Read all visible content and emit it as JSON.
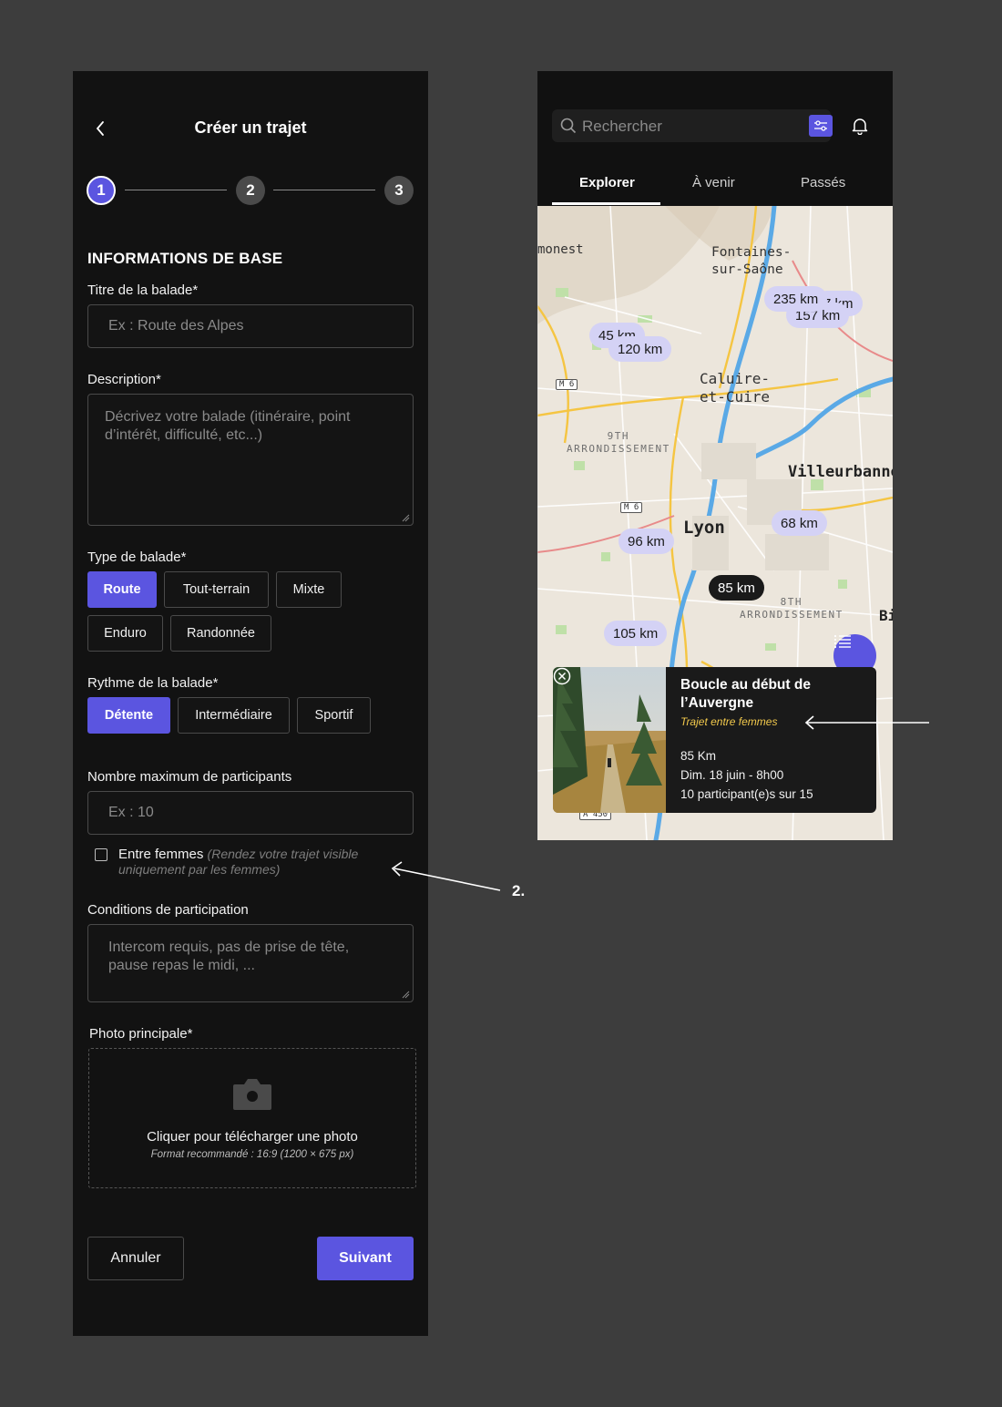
{
  "form": {
    "title": "Créer un trajet",
    "steps": [
      "1",
      "2",
      "3"
    ],
    "section_title": "INFORMATIONS DE BASE",
    "title_label": "Titre de la balade*",
    "title_placeholder": "Ex : Route des Alpes",
    "description_label": "Description*",
    "description_placeholder_1": "Décrivez votre balade (itinéraire, point",
    "description_placeholder_2": "d’intérêt, difficulté, etc...)",
    "type_label": "Type de balade*",
    "type_options": [
      "Route",
      "Tout-terrain",
      "Mixte",
      "Enduro",
      "Randonnée"
    ],
    "type_selected": "Route",
    "pace_label": "Rythme de la balade*",
    "pace_options": [
      "Détente",
      "Intermédiaire",
      "Sportif"
    ],
    "pace_selected": "Détente",
    "max_label": "Nombre maximum de participants",
    "max_placeholder": "Ex : 10",
    "women_label": "Entre femmes",
    "women_hint_1": "(Rendez votre trajet visible",
    "women_hint_2": "uniquement par les femmes)",
    "conditions_label": "Conditions de participation",
    "conditions_placeholder_1": "Intercom requis, pas de prise de tête,",
    "conditions_placeholder_2": "pause repas le midi, ...",
    "photo_label": "Photo principale*",
    "upload_text": "Cliquer pour télécharger une photo",
    "upload_hint": "Format recommandé : 16:9 (1200 × 675 px)",
    "cancel": "Annuler",
    "next": "Suivant"
  },
  "explore": {
    "search_placeholder": "Rechercher",
    "tabs": [
      "Explorer",
      "À venir",
      "Passés"
    ],
    "active_tab": "Explorer",
    "places": {
      "monest": "monest",
      "fontaines_1": "Fontaines-",
      "fontaines_2": "sur-Saône",
      "caluire_1": "Caluire-",
      "caluire_2": "et-Cuire",
      "arr9_1": "9TH",
      "arr9_2": "ARRONDISSEMENT",
      "villeurbanne": "Villeurbanne",
      "lyon": "Lyon",
      "arr8_1": "8TH",
      "arr8_2": "ARRONDISSEMENT",
      "m6": "M 6",
      "a450": "A 450",
      "bi": "Bi"
    },
    "markers": [
      "235 km",
      "7 km",
      "157 km",
      "45 km",
      "120 km",
      "68 km",
      "96 km",
      "85 km",
      "105 km"
    ],
    "selected_marker": "85 km",
    "card": {
      "title": "Boucle au début de l’Auvergne",
      "tag": "Trajet entre femmes",
      "distance": "85 Km",
      "date": "Dim. 18 juin - 8h00",
      "participants": "10 participant(e)s sur 15"
    }
  },
  "annotation": "2.",
  "colors": {
    "accent": "#5b55e0",
    "background": "#3d3d3d",
    "panel": "#121212",
    "tag": "#f2c94c"
  }
}
